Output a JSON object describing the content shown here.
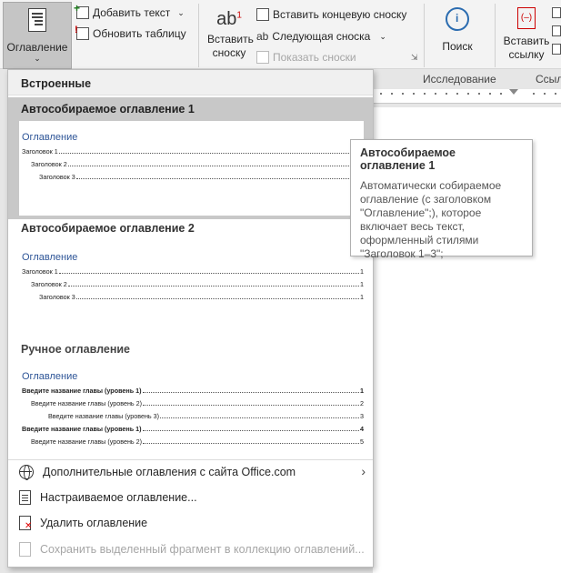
{
  "ribbon": {
    "toc_button_label": "Оглавление",
    "add_text_label": "Добавить текст",
    "update_table_label": "Обновить таблицу",
    "insert_footnote_label": "Вставить сноску",
    "insert_endnote_label": "Вставить концевую сноску",
    "next_footnote_label": "Следующая сноска",
    "show_notes_label": "Показать сноски",
    "search_label": "Поиск",
    "research_group_label": "Исследование",
    "insert_link_label": "Вставить ссылку",
    "links_group_partial": "Ссыл"
  },
  "gallery": {
    "builtin_header": "Встроенные",
    "templates": [
      {
        "title": "Автособираемое оглавление 1",
        "preview_heading": "Оглавление",
        "lines": [
          {
            "text": "Заголовок 1",
            "page": "1"
          },
          {
            "text": "Заголовок 2",
            "page": "1"
          },
          {
            "text": "Заголовок 3",
            "page": "1"
          }
        ]
      },
      {
        "title": "Автособираемое оглавление 2",
        "preview_heading": "Оглавление",
        "lines": [
          {
            "text": "Заголовок 1",
            "page": "1"
          },
          {
            "text": "Заголовок 2",
            "page": "1"
          },
          {
            "text": "Заголовок 3",
            "page": "1"
          }
        ]
      },
      {
        "title": "Ручное оглавление",
        "preview_heading": "Оглавление",
        "lines": [
          {
            "text": "Введите название главы (уровень 1)",
            "page": "1"
          },
          {
            "text": "Введите название главы (уровень 2)",
            "page": "2"
          },
          {
            "text": "Введите название главы (уровень 3)",
            "page": "3"
          },
          {
            "text": "Введите название главы (уровень 1)",
            "page": "4"
          },
          {
            "text": "Введите название главы (уровень 2)",
            "page": "5"
          }
        ]
      }
    ],
    "menu": {
      "more_online": "Дополнительные оглавления с сайта Office.com",
      "custom_toc": "Настраиваемое оглавление...",
      "remove_toc": "Удалить оглавление",
      "save_selection": "Сохранить выделенный фрагмент в коллекцию оглавлений..."
    }
  },
  "tooltip": {
    "title": "Автособираемое оглавление 1",
    "body": "Автоматически собираемое оглавление (с заголовком \"Оглавление\";), которое включает весь текст, оформленный стилями \"Заголовок 1–3\";"
  },
  "colors": {
    "heading_blue": "#2e5597",
    "selected_bg": "#c8c8c8",
    "ribbon_bg": "#f3f3f3"
  }
}
